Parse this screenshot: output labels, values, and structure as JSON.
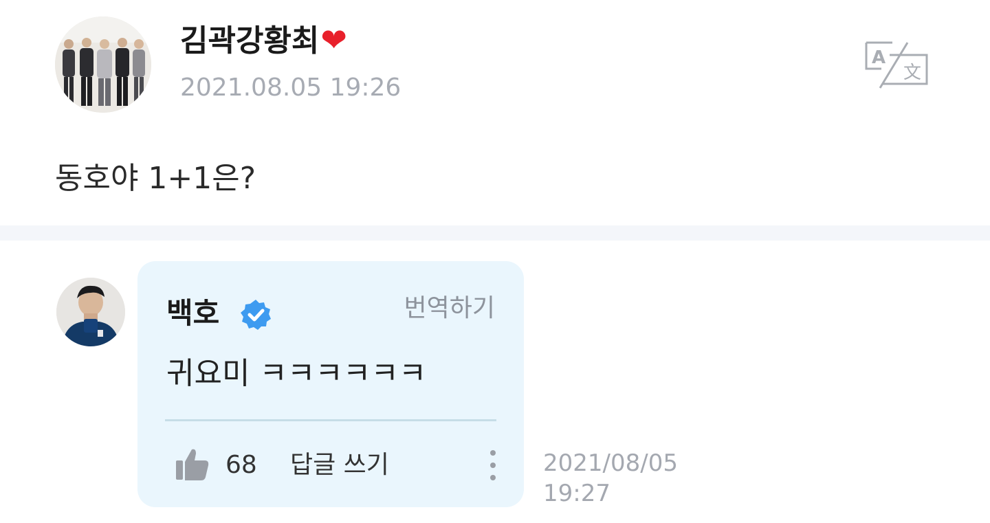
{
  "post": {
    "author": "김곽강황최",
    "author_emoji": "❤",
    "timestamp": "2021.08.05 19:26",
    "body": "동호야 1+1은?",
    "avatar_icon": "group-photo-avatar",
    "translate_icon": "translate-icon"
  },
  "comment": {
    "author": "백호",
    "verified_icon": "verified-badge-icon",
    "translate_label": "번역하기",
    "text": "귀요미 ㅋㅋㅋㅋㅋㅋ",
    "like_icon": "thumbs-up-icon",
    "like_count": "68",
    "reply_label": "답글 쓰기",
    "more_icon": "more-vertical-icon",
    "date": "2021/08/05",
    "time": "19:27"
  },
  "colors": {
    "bubble_bg": "#eaf6fd",
    "verified_blue": "#3e9bf0",
    "heart_red": "#e8202b",
    "muted_text": "#a4a8b0",
    "divider": "#f4f6fa"
  }
}
